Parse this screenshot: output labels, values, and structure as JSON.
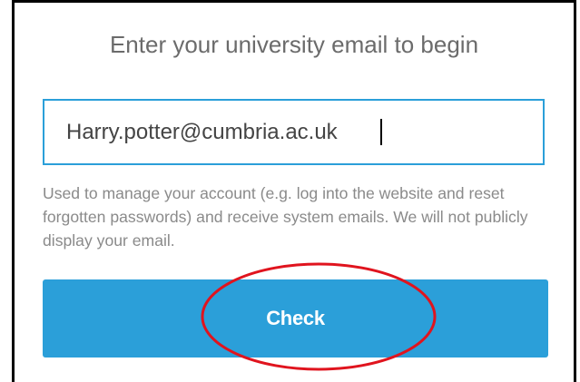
{
  "form": {
    "heading": "Enter your university email to begin",
    "email_value": "Harry.potter@cumbria.ac.uk",
    "help_text": "Used to manage your account (e.g. log into the website and reset forgotten passwords) and receive system emails. We will not publicly display your email.",
    "check_label": "Check"
  },
  "colors": {
    "accent": "#2b9fd9",
    "annotation": "#e0141e"
  }
}
